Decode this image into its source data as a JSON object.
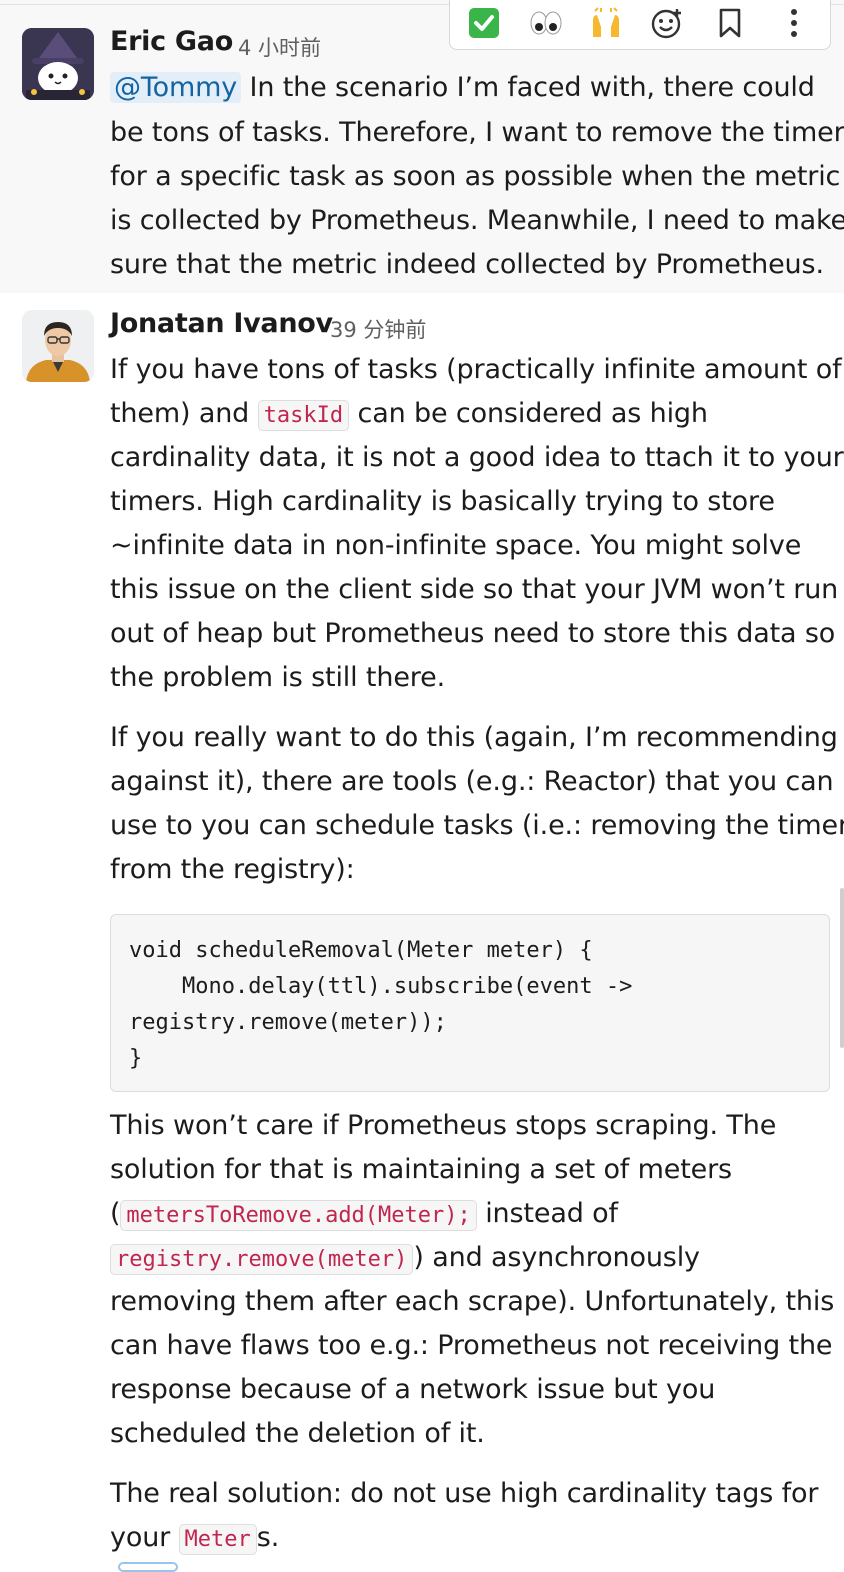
{
  "toolbar": {
    "check": "✅",
    "eyes": "👀",
    "hands": "🙌",
    "add_reaction": "☺",
    "bookmark": "",
    "more": "⋮"
  },
  "messages": [
    {
      "author": "Eric Gao",
      "time": "4 小时前",
      "mention": "@Tommy",
      "lines": [
        " In the scenario I’m faced with, there could",
        "be tons of tasks. Therefore, I want to remove the timer",
        "for a specific task as soon as possible when the metric",
        "is collected by Prometheus. Meanwhile, I need to make",
        "sure that the metric indeed collected by Prometheus."
      ]
    },
    {
      "author": "Jonatan Ivanov",
      "time": "39 分钟前",
      "p1": {
        "l1": "If you have tons of tasks (practically infinite amount of",
        "l2a": "them) and ",
        "l2code": "taskId",
        "l2b": " can be considered as high",
        "l3": "cardinality data, it is not a good idea to ttach it to your",
        "l4": "timers. High cardinality is basically trying to store",
        "l5": "~infinite data in non-infinite space. You might solve",
        "l6": "this issue on the client side so that your JVM won’t run",
        "l7": "out of heap but Prometheus need to store this data so",
        "l8": "the problem is still there."
      },
      "p2": [
        "If you really want to do this (again, I’m recommending",
        "against it), there are tools (e.g.: Reactor) that you can",
        "use to you can schedule tasks (i.e.: removing the timer",
        "from the registry):"
      ],
      "code": [
        "void scheduleRemoval(Meter meter) {",
        "    Mono.delay(ttl).subscribe(event ->",
        "registry.remove(meter));",
        "}"
      ],
      "p3": {
        "l1": "This won’t care if Prometheus stops scraping. The",
        "l2": "solution for that is maintaining a set of meters",
        "l3a": "(",
        "l3code": "metersToRemove.add(Meter);",
        "l3b": " instead of",
        "l4code": "registry.remove(meter)",
        "l4b": ") and asynchronously",
        "l5": "removing them after each scrape). Unfortunately, this",
        "l6": "can have flaws too e.g.: Prometheus not receiving the",
        "l7": "response because of a network issue but you",
        "l8": "scheduled the deletion of it."
      },
      "p4": {
        "l1": "The real solution: do not use high cardinality tags for",
        "l2a": "your ",
        "l2code": "Meter",
        "l2b": "s."
      }
    }
  ]
}
